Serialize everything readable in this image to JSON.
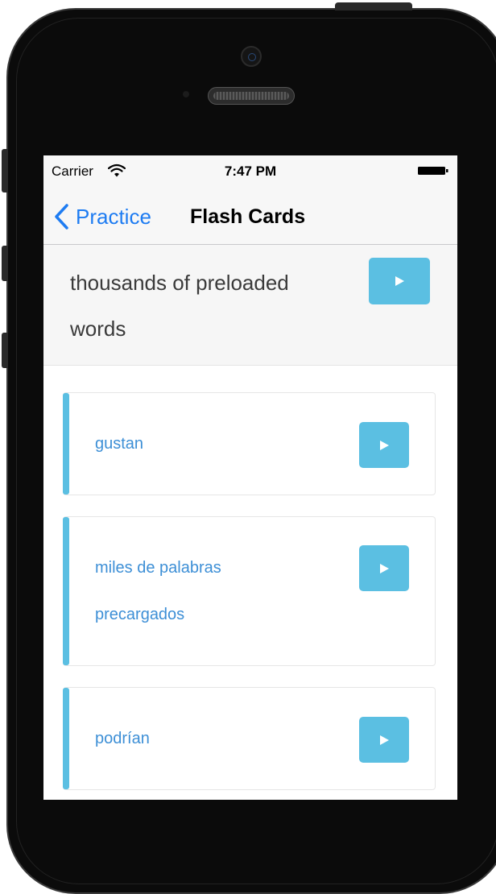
{
  "status_bar": {
    "carrier": "Carrier",
    "time": "7:47 PM"
  },
  "nav": {
    "back_label": "Practice",
    "title": "Flash Cards"
  },
  "header_card": {
    "text": "thousands of preloaded words"
  },
  "cards": [
    {
      "text": "gustan"
    },
    {
      "text": "miles de palabras precargados"
    },
    {
      "text": "podrían"
    }
  ],
  "colors": {
    "accent": "#5bbfe2",
    "link": "#1e7cf2",
    "word": "#3d8fd6"
  },
  "icons": [
    "wifi-icon",
    "battery-icon",
    "back-chevron-icon",
    "play-icon"
  ]
}
